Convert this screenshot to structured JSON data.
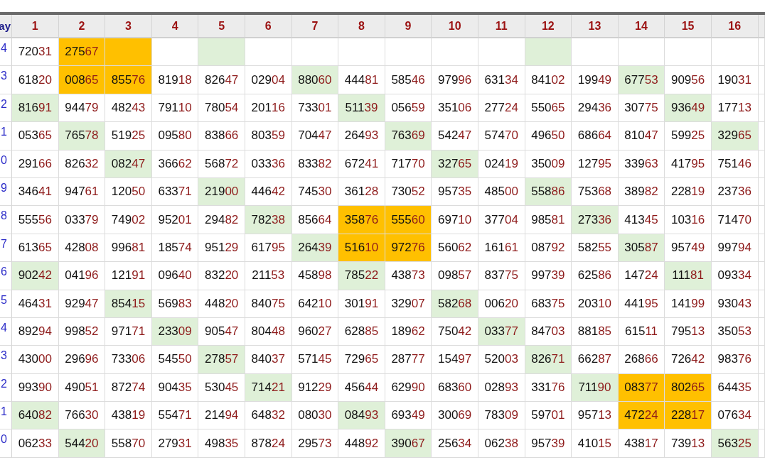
{
  "table": {
    "corner": "ay",
    "columns": [
      "1",
      "2",
      "3",
      "4",
      "5",
      "6",
      "7",
      "8",
      "9",
      "10",
      "11",
      "12",
      "13",
      "14",
      "15",
      "16"
    ],
    "rows": [
      {
        "label": "4",
        "cells": [
          {
            "value": "72031"
          },
          {
            "value": "27567",
            "color": "#ffc000"
          },
          {
            "color": "#ffc000"
          },
          {},
          {
            "color": "#dff0d8"
          },
          {},
          {},
          {},
          {},
          {},
          {},
          {
            "color": "#dff0d8"
          },
          {},
          {},
          {},
          {}
        ]
      },
      {
        "label": "3",
        "cells": [
          {
            "value": "61820"
          },
          {
            "value": "00865",
            "color": "#ffc000"
          },
          {
            "value": "85576",
            "color": "#ffc000"
          },
          {
            "value": "81918"
          },
          {
            "value": "82647"
          },
          {
            "value": "02904"
          },
          {
            "value": "88060",
            "color": "#dff0d8"
          },
          {
            "value": "44481"
          },
          {
            "value": "58546"
          },
          {
            "value": "97996"
          },
          {
            "value": "63134"
          },
          {
            "value": "84102"
          },
          {
            "value": "19949"
          },
          {
            "value": "67753",
            "color": "#dff0d8"
          },
          {
            "value": "90956"
          },
          {
            "value": "19031"
          }
        ]
      },
      {
        "label": "2",
        "cells": [
          {
            "value": "81691",
            "color": "#dff0d8"
          },
          {
            "value": "94479"
          },
          {
            "value": "48243"
          },
          {
            "value": "79110"
          },
          {
            "value": "78054"
          },
          {
            "value": "20116"
          },
          {
            "value": "73301"
          },
          {
            "value": "51139",
            "color": "#dff0d8"
          },
          {
            "value": "05659"
          },
          {
            "value": "35106"
          },
          {
            "value": "27724"
          },
          {
            "value": "55065"
          },
          {
            "value": "29436"
          },
          {
            "value": "30775"
          },
          {
            "value": "93649",
            "color": "#dff0d8"
          },
          {
            "value": "17713"
          }
        ]
      },
      {
        "label": "1",
        "cells": [
          {
            "value": "05365"
          },
          {
            "value": "76578",
            "color": "#dff0d8"
          },
          {
            "value": "51925"
          },
          {
            "value": "09580"
          },
          {
            "value": "83866"
          },
          {
            "value": "80359"
          },
          {
            "value": "70447"
          },
          {
            "value": "26493"
          },
          {
            "value": "76369",
            "color": "#dff0d8"
          },
          {
            "value": "54247"
          },
          {
            "value": "57470"
          },
          {
            "value": "49650"
          },
          {
            "value": "68664"
          },
          {
            "value": "81047"
          },
          {
            "value": "59925"
          },
          {
            "value": "32965",
            "color": "#dff0d8"
          }
        ]
      },
      {
        "label": "0",
        "cells": [
          {
            "value": "29166"
          },
          {
            "value": "82632"
          },
          {
            "value": "08247",
            "color": "#dff0d8"
          },
          {
            "value": "36662"
          },
          {
            "value": "56872"
          },
          {
            "value": "03336"
          },
          {
            "value": "83382"
          },
          {
            "value": "67241"
          },
          {
            "value": "71770"
          },
          {
            "value": "32765",
            "color": "#dff0d8"
          },
          {
            "value": "02419"
          },
          {
            "value": "35009"
          },
          {
            "value": "12795"
          },
          {
            "value": "33963"
          },
          {
            "value": "41795"
          },
          {
            "value": "75146"
          }
        ]
      },
      {
        "label": "9",
        "cells": [
          {
            "value": "34641"
          },
          {
            "value": "94761"
          },
          {
            "value": "12050"
          },
          {
            "value": "63371"
          },
          {
            "value": "21900",
            "color": "#dff0d8"
          },
          {
            "value": "44642"
          },
          {
            "value": "74530"
          },
          {
            "value": "36128"
          },
          {
            "value": "73052"
          },
          {
            "value": "95735"
          },
          {
            "value": "48500"
          },
          {
            "value": "55886",
            "color": "#dff0d8"
          },
          {
            "value": "75368"
          },
          {
            "value": "38982"
          },
          {
            "value": "22819"
          },
          {
            "value": "23736"
          }
        ]
      },
      {
        "label": "8",
        "cells": [
          {
            "value": "55556"
          },
          {
            "value": "03379"
          },
          {
            "value": "74902"
          },
          {
            "value": "95201"
          },
          {
            "value": "29482"
          },
          {
            "value": "78238",
            "color": "#dff0d8"
          },
          {
            "value": "85664"
          },
          {
            "value": "35876",
            "color": "#ffc000"
          },
          {
            "value": "55560",
            "color": "#ffc000"
          },
          {
            "value": "69710"
          },
          {
            "value": "37704"
          },
          {
            "value": "98581"
          },
          {
            "value": "27336",
            "color": "#dff0d8"
          },
          {
            "value": "41345"
          },
          {
            "value": "10316"
          },
          {
            "value": "71470"
          }
        ]
      },
      {
        "label": "7",
        "cells": [
          {
            "value": "61365"
          },
          {
            "value": "42808"
          },
          {
            "value": "99681"
          },
          {
            "value": "18574"
          },
          {
            "value": "95129"
          },
          {
            "value": "61795"
          },
          {
            "value": "26439",
            "color": "#dff0d8"
          },
          {
            "value": "51610",
            "color": "#ffc000"
          },
          {
            "value": "97276",
            "color": "#ffc000"
          },
          {
            "value": "56062"
          },
          {
            "value": "16161"
          },
          {
            "value": "08792"
          },
          {
            "value": "58255"
          },
          {
            "value": "30587",
            "color": "#dff0d8"
          },
          {
            "value": "95749"
          },
          {
            "value": "99794"
          }
        ]
      },
      {
        "label": "6",
        "cells": [
          {
            "value": "90242",
            "color": "#dff0d8"
          },
          {
            "value": "04196"
          },
          {
            "value": "12191"
          },
          {
            "value": "09640"
          },
          {
            "value": "83220"
          },
          {
            "value": "21153"
          },
          {
            "value": "45898"
          },
          {
            "value": "78522",
            "color": "#dff0d8"
          },
          {
            "value": "43873"
          },
          {
            "value": "09857"
          },
          {
            "value": "83775"
          },
          {
            "value": "99739"
          },
          {
            "value": "62586"
          },
          {
            "value": "14724"
          },
          {
            "value": "11181",
            "color": "#dff0d8"
          },
          {
            "value": "09334"
          }
        ]
      },
      {
        "label": "5",
        "cells": [
          {
            "value": "46431"
          },
          {
            "value": "92947"
          },
          {
            "value": "85415",
            "color": "#dff0d8"
          },
          {
            "value": "56983"
          },
          {
            "value": "44820"
          },
          {
            "value": "84075"
          },
          {
            "value": "64210"
          },
          {
            "value": "30191"
          },
          {
            "value": "32907"
          },
          {
            "value": "58268",
            "color": "#dff0d8"
          },
          {
            "value": "00620"
          },
          {
            "value": "68375"
          },
          {
            "value": "20310"
          },
          {
            "value": "44195"
          },
          {
            "value": "14199"
          },
          {
            "value": "93043"
          }
        ]
      },
      {
        "label": "4",
        "cells": [
          {
            "value": "89294"
          },
          {
            "value": "99852"
          },
          {
            "value": "97171"
          },
          {
            "value": "23309",
            "color": "#dff0d8"
          },
          {
            "value": "90547"
          },
          {
            "value": "80448"
          },
          {
            "value": "96027"
          },
          {
            "value": "62885"
          },
          {
            "value": "18962"
          },
          {
            "value": "75042"
          },
          {
            "value": "03377",
            "color": "#dff0d8"
          },
          {
            "value": "84703"
          },
          {
            "value": "88185"
          },
          {
            "value": "61511"
          },
          {
            "value": "79513"
          },
          {
            "value": "35053"
          }
        ]
      },
      {
        "label": "3",
        "cells": [
          {
            "value": "43000"
          },
          {
            "value": "29696"
          },
          {
            "value": "73306"
          },
          {
            "value": "54550"
          },
          {
            "value": "27857",
            "color": "#dff0d8"
          },
          {
            "value": "84037"
          },
          {
            "value": "57145"
          },
          {
            "value": "72965"
          },
          {
            "value": "28777"
          },
          {
            "value": "15497"
          },
          {
            "value": "52003"
          },
          {
            "value": "82671",
            "color": "#dff0d8"
          },
          {
            "value": "66287"
          },
          {
            "value": "26866"
          },
          {
            "value": "72642"
          },
          {
            "value": "98376"
          }
        ]
      },
      {
        "label": "2",
        "cells": [
          {
            "value": "99390"
          },
          {
            "value": "49051"
          },
          {
            "value": "87274"
          },
          {
            "value": "90435"
          },
          {
            "value": "53045"
          },
          {
            "value": "71421",
            "color": "#dff0d8"
          },
          {
            "value": "91229"
          },
          {
            "value": "45644"
          },
          {
            "value": "62990"
          },
          {
            "value": "68360"
          },
          {
            "value": "02893"
          },
          {
            "value": "33176"
          },
          {
            "value": "71190",
            "color": "#dff0d8"
          },
          {
            "value": "08377",
            "color": "#ffc000"
          },
          {
            "value": "80265",
            "color": "#ffc000"
          },
          {
            "value": "64435"
          }
        ]
      },
      {
        "label": "1",
        "cells": [
          {
            "value": "64082",
            "color": "#dff0d8"
          },
          {
            "value": "76630"
          },
          {
            "value": "43819"
          },
          {
            "value": "55471"
          },
          {
            "value": "21494"
          },
          {
            "value": "64832"
          },
          {
            "value": "08030"
          },
          {
            "value": "08493",
            "color": "#dff0d8"
          },
          {
            "value": "69349"
          },
          {
            "value": "30069"
          },
          {
            "value": "78309"
          },
          {
            "value": "59701"
          },
          {
            "value": "95713"
          },
          {
            "value": "47224",
            "color": "#ffc000"
          },
          {
            "value": "22817",
            "color": "#ffc000"
          },
          {
            "value": "07634"
          }
        ]
      },
      {
        "label": "0",
        "cells": [
          {
            "value": "06233"
          },
          {
            "value": "54420",
            "color": "#dff0d8"
          },
          {
            "value": "55870"
          },
          {
            "value": "27931"
          },
          {
            "value": "49835"
          },
          {
            "value": "87824"
          },
          {
            "value": "29573"
          },
          {
            "value": "44892"
          },
          {
            "value": "39067",
            "color": "#dff0d8"
          },
          {
            "value": "25634"
          },
          {
            "value": "06238"
          },
          {
            "value": "95739"
          },
          {
            "value": "41015"
          },
          {
            "value": "43817"
          },
          {
            "value": "73913"
          },
          {
            "value": "56325",
            "color": "#dff0d8"
          }
        ]
      }
    ]
  }
}
